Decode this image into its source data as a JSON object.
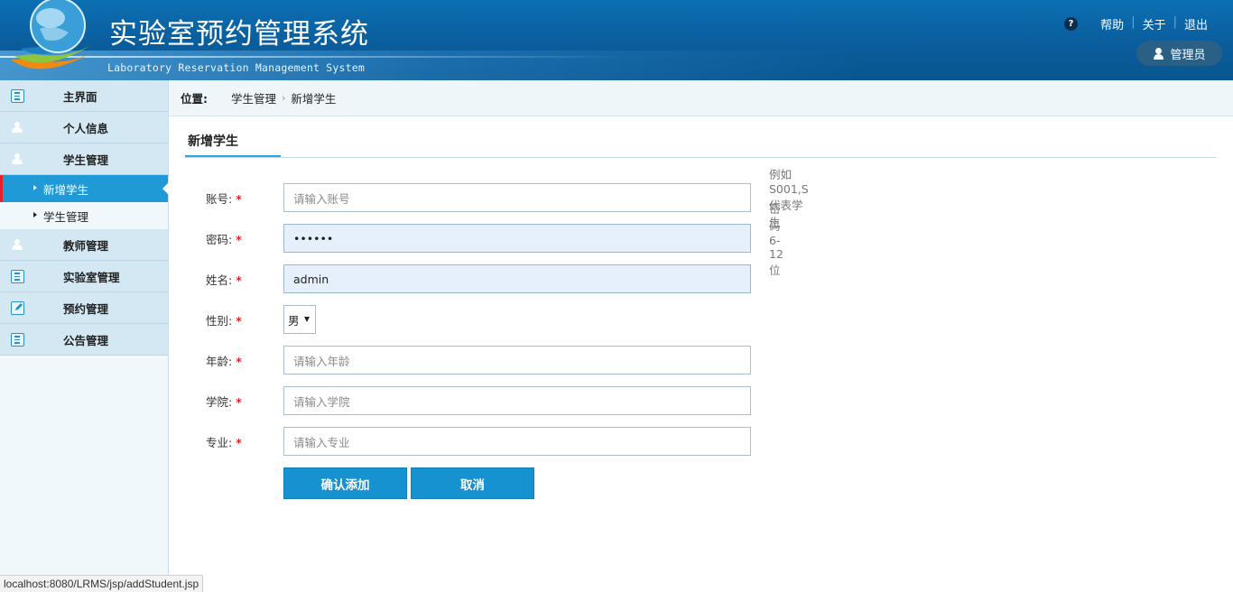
{
  "header": {
    "title": "实验室预约管理系统",
    "subtitle": "Laboratory Reservation Management System",
    "links": [
      "帮助",
      "关于",
      "退出"
    ],
    "user": "管理员",
    "help_icon": "question-icon"
  },
  "sidebar": {
    "items": [
      {
        "label": "主界面",
        "icon": "list-icon"
      },
      {
        "label": "个人信息",
        "icon": "person-icon"
      },
      {
        "label": "学生管理",
        "icon": "person-icon"
      }
    ],
    "subitems": [
      {
        "label": "新增学生",
        "active": true
      },
      {
        "label": "学生管理",
        "active": false
      }
    ],
    "items2": [
      {
        "label": "教师管理",
        "icon": "person-icon"
      },
      {
        "label": "实验室管理",
        "icon": "list-icon"
      },
      {
        "label": "预约管理",
        "icon": "edit-icon"
      },
      {
        "label": "公告管理",
        "icon": "list-icon"
      }
    ]
  },
  "breadcrumb": {
    "label": "位置:",
    "items": [
      "学生管理",
      "新增学生"
    ]
  },
  "section": {
    "title": "新增学生"
  },
  "form": {
    "account": {
      "label": "账号:",
      "placeholder": "请输入账号",
      "hint": "例如S001,S代表学生"
    },
    "password": {
      "label": "密码:",
      "value": "••••••",
      "hint": "密码6-12位"
    },
    "name": {
      "label": "姓名:",
      "value": "admin"
    },
    "gender": {
      "label": "性别:",
      "value": "男"
    },
    "age": {
      "label": "年龄:",
      "placeholder": "请输入年龄"
    },
    "college": {
      "label": "学院:",
      "placeholder": "请输入学院"
    },
    "major": {
      "label": "专业:",
      "placeholder": "请输入专业"
    },
    "required_mark": "*"
  },
  "buttons": {
    "confirm": "确认添加",
    "cancel": "取消"
  },
  "status": {
    "url": "localhost:8080/LRMS/jsp/addStudent.jsp"
  },
  "colors": {
    "header": "#0a5d9c",
    "accent": "#1592cf",
    "active_menu": "#1f9ad6",
    "required": "#e0242a"
  }
}
